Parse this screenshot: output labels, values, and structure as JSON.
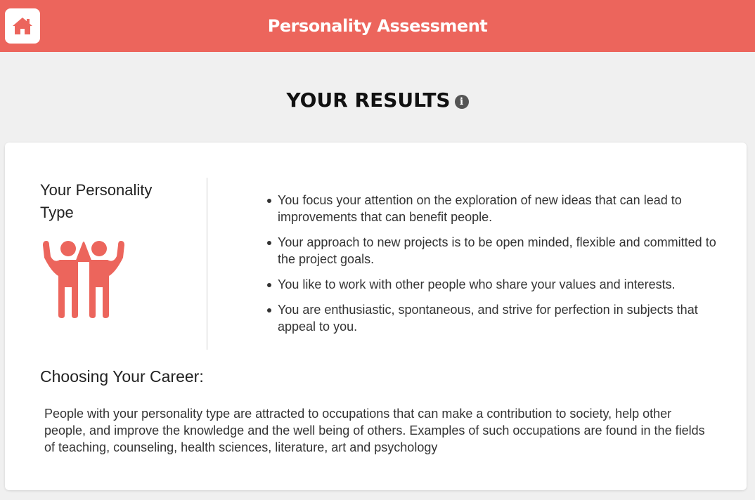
{
  "header": {
    "title": "Personality Assessment",
    "home_icon": "home-icon",
    "color": "#ec655c"
  },
  "results": {
    "title": "YOUR RESULTS",
    "info_icon": "info-icon",
    "info_glyph": "i"
  },
  "personality": {
    "label": "Your Personality Type",
    "icon": "two-people-cheering-icon",
    "icon_color": "#ec655c",
    "traits": [
      "You focus your attention on the exploration of new ideas that can lead to improvements that can benefit people.",
      "Your approach to new projects is to be open minded, flexible and committed to the project goals.",
      "You like to work with other people who share your values and interests.",
      "You are enthusiastic, spontaneous, and strive for perfection in subjects that appeal to you."
    ]
  },
  "career": {
    "title": "Choosing Your Career:",
    "text": "People with your personality type are attracted to occupations that can make a contribution to society, help other people, and improve the knowledge and the well being of others. Examples of such occupations are found in the fields of teaching, counseling, health sciences, literature, art and psychology"
  }
}
